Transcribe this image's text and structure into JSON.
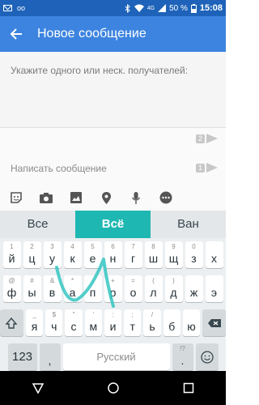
{
  "status_bar": {
    "left_icons": [
      "mail-icon",
      "voicemail-icon"
    ],
    "right_icons": [
      "bluetooth-icon",
      "wifi-icon",
      "signal-4g-icon",
      "battery-icon"
    ],
    "network": "4G",
    "battery": "50 %",
    "time": "15:08"
  },
  "app_bar": {
    "title": "Новое сообщение",
    "back_icon": "arrow-back-icon"
  },
  "recipient": {
    "placeholder": "Укажите одного или неск. получателей:"
  },
  "message": {
    "placeholder": "Написать сообщение",
    "sim_send": [
      {
        "sim": "2"
      },
      {
        "sim": "1"
      }
    ]
  },
  "attachments": [
    "sticker-icon",
    "camera-icon",
    "image-icon",
    "location-icon",
    "microphone-icon",
    "more-icon"
  ],
  "keyboard": {
    "suggestions": [
      "Все",
      "Всё",
      "Ван"
    ],
    "row1": [
      {
        "key": "й",
        "hint": "1"
      },
      {
        "key": "ц",
        "hint": "2"
      },
      {
        "key": "у",
        "hint": "3"
      },
      {
        "key": "к",
        "hint": "4"
      },
      {
        "key": "е",
        "hint": "5"
      },
      {
        "key": "н",
        "hint": "6"
      },
      {
        "key": "г",
        "hint": "7"
      },
      {
        "key": "ш",
        "hint": "8"
      },
      {
        "key": "щ",
        "hint": "9"
      },
      {
        "key": "з",
        "hint": "0"
      },
      {
        "key": "х",
        "hint": ""
      }
    ],
    "row2": [
      {
        "key": "ф",
        "hint": "@"
      },
      {
        "key": "ы",
        "hint": "#"
      },
      {
        "key": "в",
        "hint": "&"
      },
      {
        "key": "а",
        "hint": "*"
      },
      {
        "key": "п",
        "hint": "-"
      },
      {
        "key": "р",
        "hint": "+"
      },
      {
        "key": "о",
        "hint": "="
      },
      {
        "key": "л",
        "hint": "("
      },
      {
        "key": "д",
        "hint": ")"
      },
      {
        "key": "ж",
        "hint": ""
      },
      {
        "key": "э",
        "hint": ""
      }
    ],
    "row3": [
      {
        "key": "я",
        "hint": "_"
      },
      {
        "key": "ч",
        "hint": "$"
      },
      {
        "key": "с",
        "hint": "\""
      },
      {
        "key": "м",
        "hint": "'"
      },
      {
        "key": "и",
        "hint": ":"
      },
      {
        "key": "т",
        "hint": ";"
      },
      {
        "key": "ь",
        "hint": "/"
      },
      {
        "key": "б",
        "hint": ""
      },
      {
        "key": "ю",
        "hint": ""
      }
    ],
    "num_key": "123",
    "comma_key": ",",
    "space_label": "Русский",
    "dot_key": ".",
    "dot_hint": "!?",
    "colors": {
      "accent": "#1fb7b2",
      "app_bar": "#3d84e0",
      "status_bar": "#1e63b9"
    }
  },
  "nav_bar": [
    "back-icon",
    "home-icon",
    "recents-icon"
  ]
}
